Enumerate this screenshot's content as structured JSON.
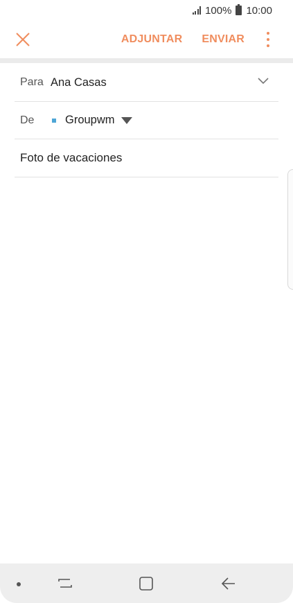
{
  "status_bar": {
    "battery_percent": "100%",
    "time": "10:00"
  },
  "toolbar": {
    "close_icon": "close-icon",
    "attach_label": "ADJUNTAR",
    "send_label": "ENVIAR",
    "more_icon": "more-vertical-icon",
    "accent_color": "#f08d5e"
  },
  "compose": {
    "to_label": "Para",
    "to_value": "Ana Casas",
    "from_label": "De",
    "from_value": "Groupwm",
    "account_color": "#4ea6d6",
    "subject": "Foto de vacaciones",
    "body": ""
  },
  "nav_bar": {
    "items": [
      "recent-apps-icon",
      "home-icon",
      "back-icon"
    ]
  }
}
